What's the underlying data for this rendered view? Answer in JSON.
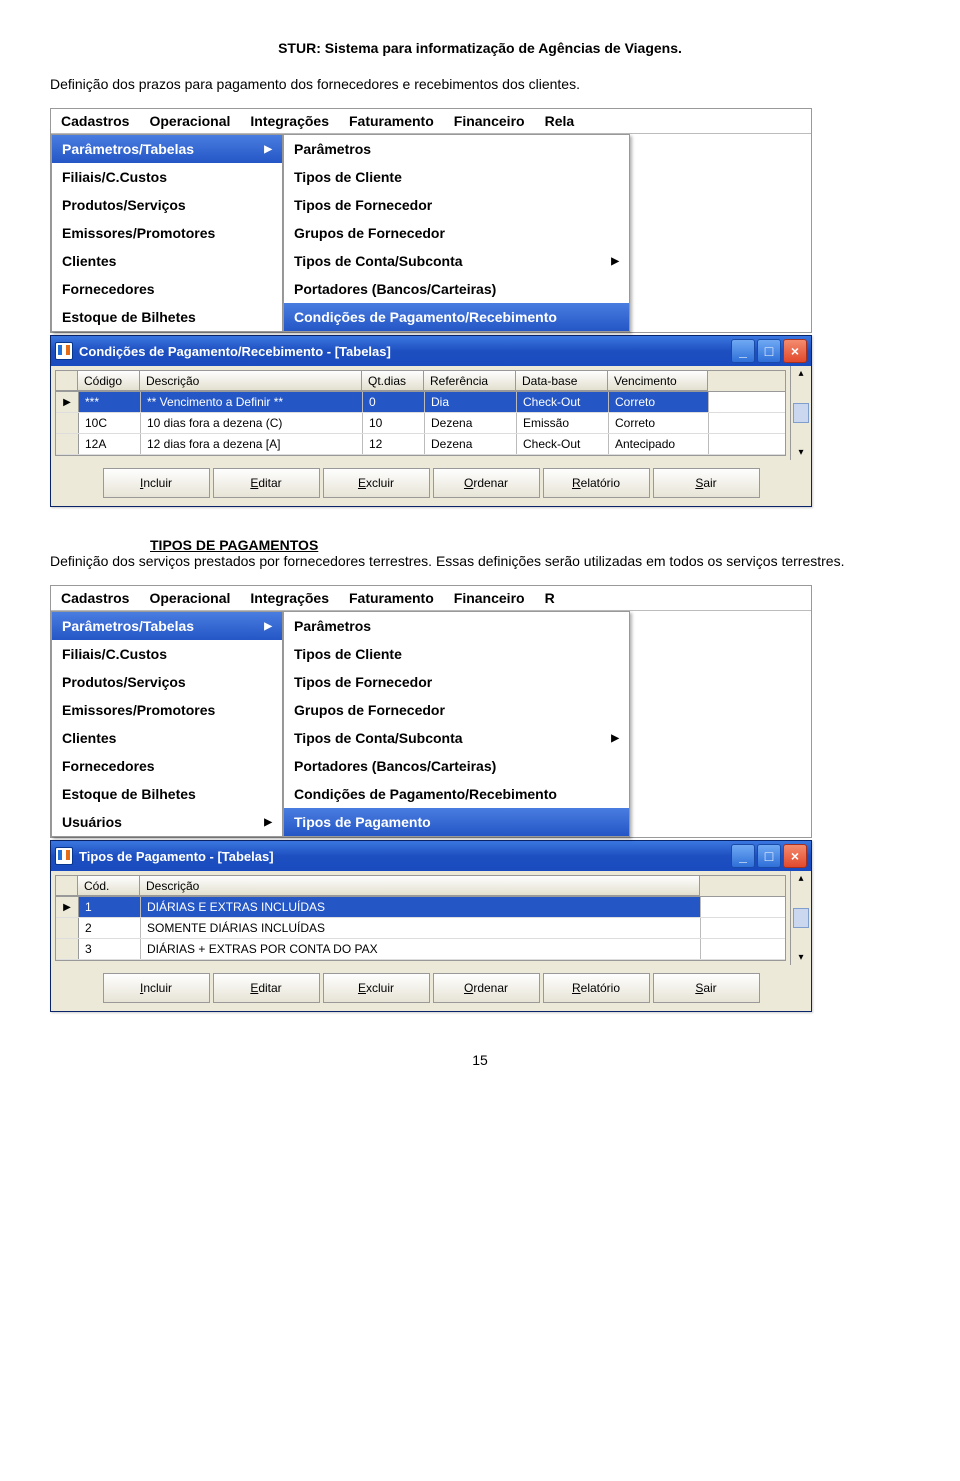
{
  "doc": {
    "title": "STUR: Sistema para informatização de Agências de Viagens.",
    "para1": "Definição dos prazos para pagamento dos fornecedores e recebimentos dos clientes.",
    "section2_title": "TIPOS DE PAGAMENTOS",
    "para2": "Definição dos serviços prestados por fornecedores terrestres. Essas definições serão utilizadas em todos os serviços terrestres.",
    "page_number": "15"
  },
  "menubar1": [
    "Cadastros",
    "Operacional",
    "Integrações",
    "Faturamento",
    "Financeiro",
    "Rela"
  ],
  "menubar2": [
    "Cadastros",
    "Operacional",
    "Integrações",
    "Faturamento",
    "Financeiro",
    "R"
  ],
  "menu1_left": [
    {
      "label": "Parâmetros/Tabelas",
      "sel": true,
      "arrow": true
    },
    {
      "label": "Filiais/C.Custos"
    },
    {
      "label": "Produtos/Serviços"
    },
    {
      "label": "Emissores/Promotores"
    },
    {
      "label": "Clientes"
    },
    {
      "label": "Fornecedores"
    },
    {
      "label": "Estoque de Bilhetes"
    }
  ],
  "menu1_right": [
    {
      "label": "Parâmetros"
    },
    {
      "label": "Tipos de Cliente"
    },
    {
      "label": "Tipos de Fornecedor"
    },
    {
      "label": "Grupos de Fornecedor"
    },
    {
      "label": "Tipos de Conta/Subconta",
      "arrow": true
    },
    {
      "label": "Portadores (Bancos/Carteiras)"
    },
    {
      "label": "Condições de Pagamento/Recebimento",
      "sel": true
    }
  ],
  "menu2_left": [
    {
      "label": "Parâmetros/Tabelas",
      "sel": true,
      "arrow": true
    },
    {
      "label": "Filiais/C.Custos"
    },
    {
      "label": "Produtos/Serviços"
    },
    {
      "label": "Emissores/Promotores"
    },
    {
      "label": "Clientes"
    },
    {
      "label": "Fornecedores"
    },
    {
      "label": "Estoque de Bilhetes"
    },
    {
      "label": "Usuários",
      "arrow": true
    }
  ],
  "menu2_right": [
    {
      "label": "Parâmetros"
    },
    {
      "label": "Tipos de Cliente"
    },
    {
      "label": "Tipos de Fornecedor"
    },
    {
      "label": "Grupos de Fornecedor"
    },
    {
      "label": "Tipos de Conta/Subconta",
      "arrow": true
    },
    {
      "label": "Portadores (Bancos/Carteiras)"
    },
    {
      "label": "Condições de Pagamento/Recebimento"
    },
    {
      "label": "Tipos de Pagamento",
      "sel": true
    }
  ],
  "win1": {
    "title": "Condições de Pagamento/Recebimento - [Tabelas]",
    "headers": [
      "Código",
      "Descrição",
      "Qt.dias",
      "Referência",
      "Data-base",
      "Vencimento"
    ],
    "rows": [
      {
        "sel": true,
        "c": [
          "***",
          "** Vencimento a Definir **",
          "0",
          "Dia",
          "Check-Out",
          "Correto"
        ]
      },
      {
        "c": [
          "10C",
          "10 dias fora a dezena (C)",
          "10",
          "Dezena",
          "Emissão",
          "Correto"
        ]
      },
      {
        "c": [
          "12A",
          "12 dias fora a dezena [A]",
          "12",
          "Dezena",
          "Check-Out",
          "Antecipado"
        ]
      }
    ]
  },
  "win2": {
    "title": "Tipos de Pagamento - [Tabelas]",
    "headers": [
      "Cód.",
      "Descrição"
    ],
    "rows": [
      {
        "sel": true,
        "c": [
          "1",
          "DIÁRIAS E EXTRAS INCLUÍDAS"
        ]
      },
      {
        "c": [
          "2",
          "SOMENTE DIÁRIAS INCLUÍDAS"
        ]
      },
      {
        "c": [
          "3",
          "DIÁRIAS + EXTRAS POR CONTA DO PAX"
        ]
      }
    ]
  },
  "toolbar": {
    "incluir": "Incluir",
    "editar": "Editar",
    "excluir": "Excluir",
    "ordenar": "Ordenar",
    "relatorio": "Relatório",
    "sair": "Sair"
  }
}
